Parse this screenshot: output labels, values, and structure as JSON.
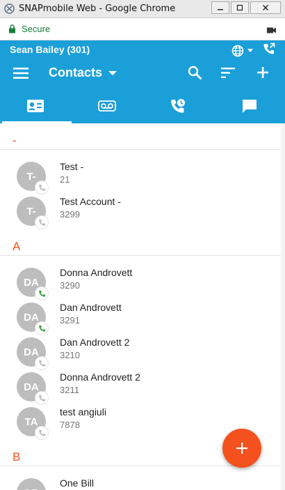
{
  "window": {
    "title": "SNAPmobile Web - Google Chrome",
    "secure_label": "Secure"
  },
  "header": {
    "user": "Sean Bailey (301)",
    "title": "Contacts"
  },
  "tabs": [
    {
      "icon": "contact-card-icon",
      "active": true
    },
    {
      "icon": "voicemail-icon",
      "active": false
    },
    {
      "icon": "call-history-icon",
      "active": false
    },
    {
      "icon": "chat-icon",
      "active": false
    }
  ],
  "sections": [
    {
      "letter": "-",
      "contacts": [
        {
          "initials": "T-",
          "name": "Test -",
          "ext": "21",
          "status": "offline"
        },
        {
          "initials": "T-",
          "name": "Test Account -",
          "ext": "3299",
          "status": "offline"
        }
      ]
    },
    {
      "letter": "A",
      "contacts": [
        {
          "initials": "DA",
          "name": "Donna Androvett",
          "ext": "3290",
          "status": "available"
        },
        {
          "initials": "DA",
          "name": "Dan Androvett",
          "ext": "3291",
          "status": "available"
        },
        {
          "initials": "DA",
          "name": "Dan Androvett 2",
          "ext": "3210",
          "status": "offline"
        },
        {
          "initials": "DA",
          "name": "Donna Androvett 2",
          "ext": "3211",
          "status": "offline"
        },
        {
          "initials": "TA",
          "name": "test angiuli",
          "ext": "7878",
          "status": "offline"
        }
      ]
    },
    {
      "letter": "B",
      "contacts": [
        {
          "initials": "OB",
          "name": "One Bill",
          "ext": "",
          "status": "offline"
        }
      ]
    }
  ],
  "colors": {
    "primary": "#1b9fd8",
    "accent": "#f4511e",
    "available": "#43a047",
    "offline": "#bdbdbd"
  },
  "fab": {
    "icon": "plus-icon"
  }
}
